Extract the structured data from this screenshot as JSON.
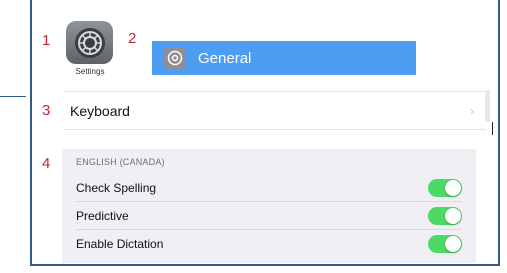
{
  "annotations": {
    "n1": "1",
    "n2": "2",
    "n3": "3",
    "n4": "4"
  },
  "settings_app": {
    "label": "Settings",
    "icon": "gear-icon"
  },
  "general": {
    "label": "General",
    "icon": "gear-icon",
    "color": "#4d9ef2"
  },
  "keyboard_row": {
    "label": "Keyboard",
    "chevron": "›"
  },
  "language_section": {
    "header": "ENGLISH (CANADA)",
    "rows": [
      {
        "label": "Check Spelling",
        "on": true
      },
      {
        "label": "Predictive",
        "on": true
      },
      {
        "label": "Enable Dictation",
        "on": true
      }
    ],
    "toggle_color": "#4cd964"
  }
}
